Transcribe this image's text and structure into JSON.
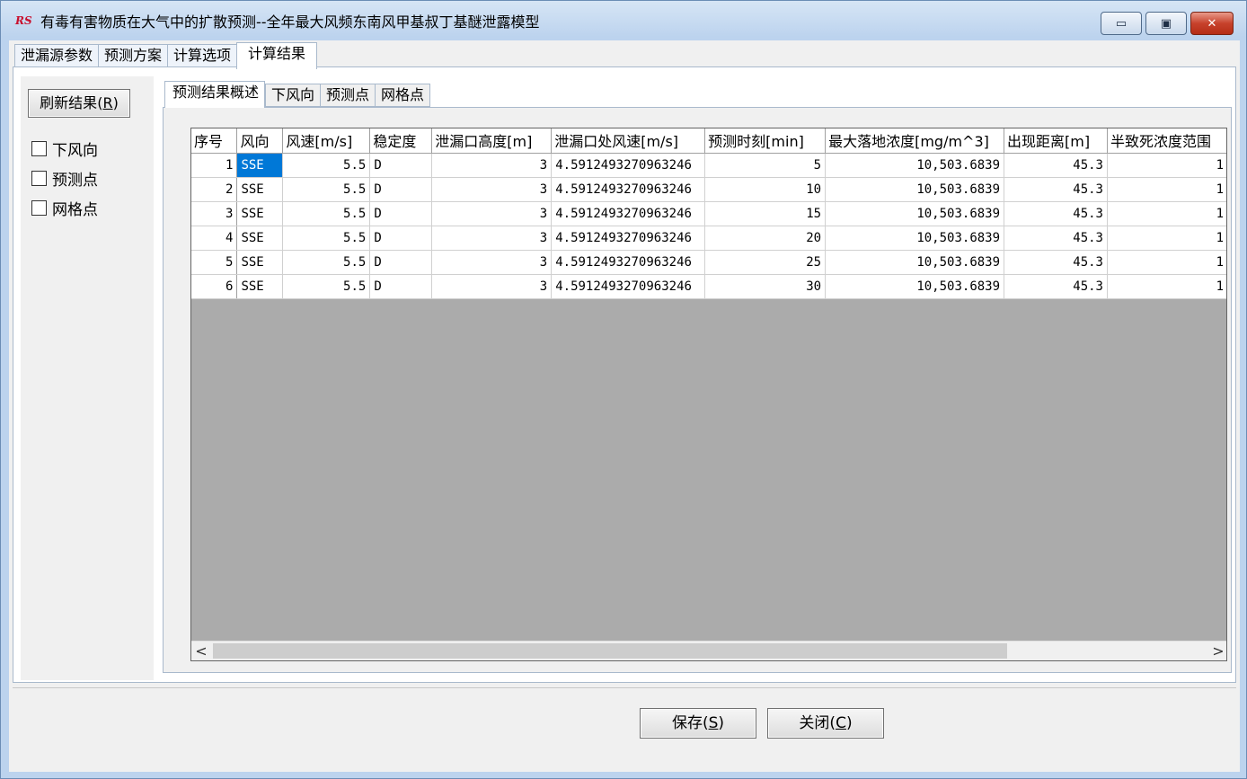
{
  "window": {
    "title": "有毒有害物质在大气中的扩散预测--全年最大风频东南风甲基叔丁基醚泄露模型",
    "icon_text": "RS",
    "minimize_glyph": "▭",
    "maximize_glyph": "▣",
    "close_glyph": "✕"
  },
  "main_tabs": [
    {
      "label": "泄漏源参数"
    },
    {
      "label": "预测方案"
    },
    {
      "label": "计算选项"
    },
    {
      "label": "计算结果"
    }
  ],
  "left": {
    "refresh_label": "刷新结果",
    "refresh_key": "R",
    "checkboxes": [
      {
        "label": "下风向",
        "checked": false
      },
      {
        "label": "预测点",
        "checked": false
      },
      {
        "label": "网格点",
        "checked": false
      }
    ]
  },
  "sub_tabs": [
    {
      "label": "预测结果概述"
    },
    {
      "label": "下风向"
    },
    {
      "label": "预测点"
    },
    {
      "label": "网格点"
    }
  ],
  "table": {
    "columns": [
      "序号",
      "风向",
      "风速[m/s]",
      "稳定度",
      "泄漏口高度[m]",
      "泄漏口处风速[m/s]",
      "预测时刻[min]",
      "最大落地浓度[mg/m^3]",
      "出现距离[m]",
      "半致死浓度范围"
    ],
    "rows": [
      [
        "1",
        "SSE",
        "5.5",
        "D",
        "3",
        "4.5912493270963246",
        "5",
        "10,503.6839",
        "45.3",
        "1"
      ],
      [
        "2",
        "SSE",
        "5.5",
        "D",
        "3",
        "4.5912493270963246",
        "10",
        "10,503.6839",
        "45.3",
        "1"
      ],
      [
        "3",
        "SSE",
        "5.5",
        "D",
        "3",
        "4.5912493270963246",
        "15",
        "10,503.6839",
        "45.3",
        "1"
      ],
      [
        "4",
        "SSE",
        "5.5",
        "D",
        "3",
        "4.5912493270963246",
        "20",
        "10,503.6839",
        "45.3",
        "1"
      ],
      [
        "5",
        "SSE",
        "5.5",
        "D",
        "3",
        "4.5912493270963246",
        "25",
        "10,503.6839",
        "45.3",
        "1"
      ],
      [
        "6",
        "SSE",
        "5.5",
        "D",
        "3",
        "4.5912493270963246",
        "30",
        "10,503.6839",
        "45.3",
        "1"
      ]
    ]
  },
  "scroll": {
    "left_glyph": "<",
    "right_glyph": ">"
  },
  "buttons": {
    "save_label": "保存",
    "save_key": "S",
    "close_label": "关闭",
    "close_key": "C"
  }
}
